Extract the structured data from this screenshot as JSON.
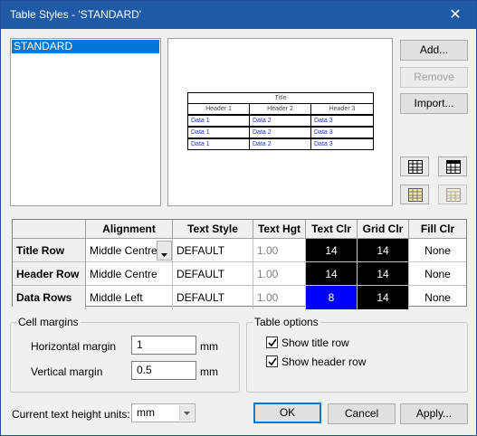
{
  "window": {
    "title": "Table Styles - 'STANDARD'",
    "close_glyph": "✕"
  },
  "styles_list": {
    "items": [
      "STANDARD"
    ],
    "selected": "STANDARD"
  },
  "buttons": {
    "add": "Add...",
    "remove": "Remove",
    "import": "Import...",
    "ok": "OK",
    "cancel": "Cancel",
    "apply": "Apply..."
  },
  "preview": {
    "title": "Title",
    "headers": [
      "Header 1",
      "Header 2",
      "Header 3"
    ],
    "rows": [
      [
        "Data 1",
        "Data 2",
        "Data 3"
      ],
      [
        "Data 1",
        "Data 2",
        "Data 3"
      ],
      [
        "Data 1",
        "Data 2",
        "Data 3"
      ]
    ]
  },
  "grid": {
    "columns": [
      "",
      "Alignment",
      "Text Style",
      "Text Hgt",
      "Text Clr",
      "Grid Clr",
      "Fill Clr"
    ],
    "rows": [
      {
        "name": "Title Row",
        "alignment": "Middle Centre",
        "text_style": "DEFAULT",
        "text_hgt": "1.00",
        "text_clr": "14",
        "text_clr_bg": "#000000",
        "grid_clr": "14",
        "grid_clr_bg": "#000000",
        "fill_clr": "None"
      },
      {
        "name": "Header Row",
        "alignment": "Middle Centre",
        "text_style": "DEFAULT",
        "text_hgt": "1.00",
        "text_clr": "14",
        "text_clr_bg": "#000000",
        "grid_clr": "14",
        "grid_clr_bg": "#000000",
        "fill_clr": "None"
      },
      {
        "name": "Data Rows",
        "alignment": "Middle Left",
        "text_style": "DEFAULT",
        "text_hgt": "1.00",
        "text_clr": "8",
        "text_clr_bg": "#0000ff",
        "grid_clr": "14",
        "grid_clr_bg": "#000000",
        "fill_clr": "None"
      }
    ]
  },
  "cell_margins": {
    "label": "Cell margins",
    "horizontal_label": "Horizontal margin",
    "horizontal_value": "1",
    "vertical_label": "Vertical margin",
    "vertical_value": "0.5",
    "unit": "mm"
  },
  "table_options": {
    "label": "Table options",
    "show_title_row": {
      "label": "Show title row",
      "checked": true
    },
    "show_header_row": {
      "label": "Show header row",
      "checked": true
    }
  },
  "text_height_units": {
    "label": "Current text height units:",
    "value": "mm"
  },
  "colors": {
    "titlebar": "#1f5aa6",
    "accent": "#0078d7",
    "blue_swatch": "#0000ff"
  }
}
